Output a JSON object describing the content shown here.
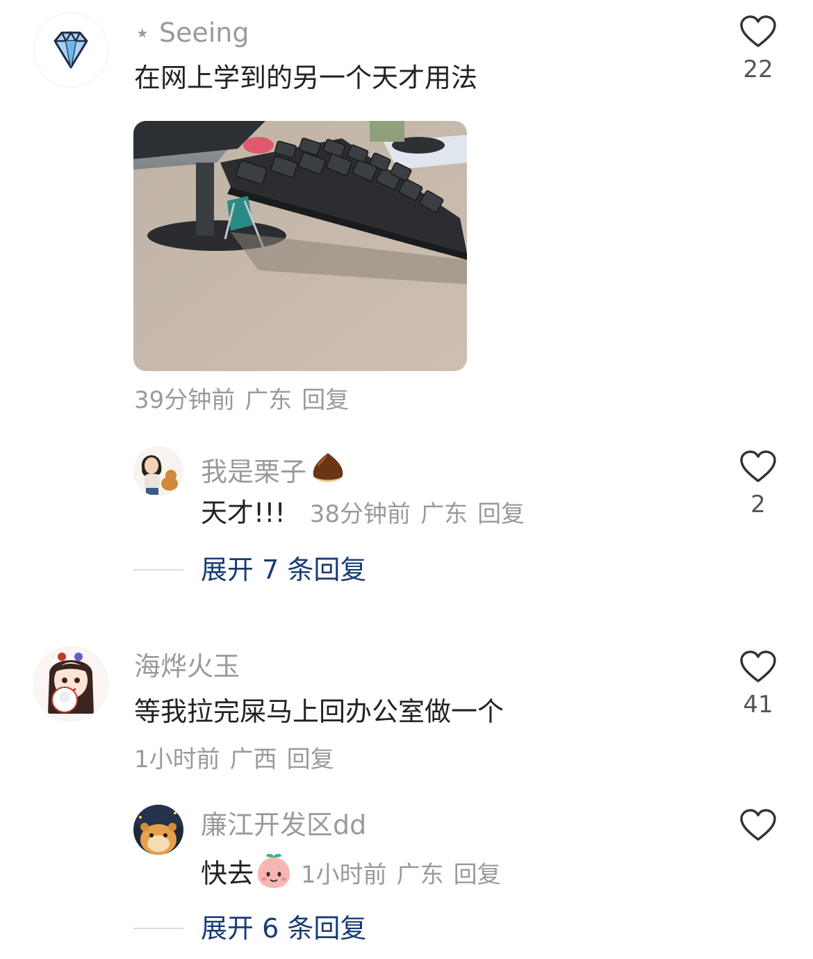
{
  "comments": [
    {
      "username": "⋆ Seeing",
      "text": "在网上学到的另一个天才用法",
      "time": "39分钟前",
      "location": "广东",
      "reply_label": "回复",
      "likes": "22",
      "reply": {
        "username": "我是栗子",
        "text": "天才!!!",
        "time": "38分钟前",
        "location": "广东",
        "reply_label": "回复",
        "likes": "2"
      },
      "expand_label": "展开 7 条回复"
    },
    {
      "username": "海烨火玉",
      "text": "等我拉完屎马上回办公室做一个",
      "time": "1小时前",
      "location": "广西",
      "reply_label": "回复",
      "likes": "41",
      "reply": {
        "username": "廉江开发区dd",
        "text": "快去",
        "time": "1小时前",
        "location": "广东",
        "reply_label": "回复",
        "likes": ""
      },
      "expand_label": "展开 6 条回复"
    }
  ],
  "colors": {
    "accent_link": "#163c74",
    "muted_text": "#9a9a9a",
    "primary_text": "#222222"
  },
  "icons": [
    "diamond-icon",
    "heart-icon",
    "chestnut-icon",
    "peach-emoji-icon"
  ]
}
